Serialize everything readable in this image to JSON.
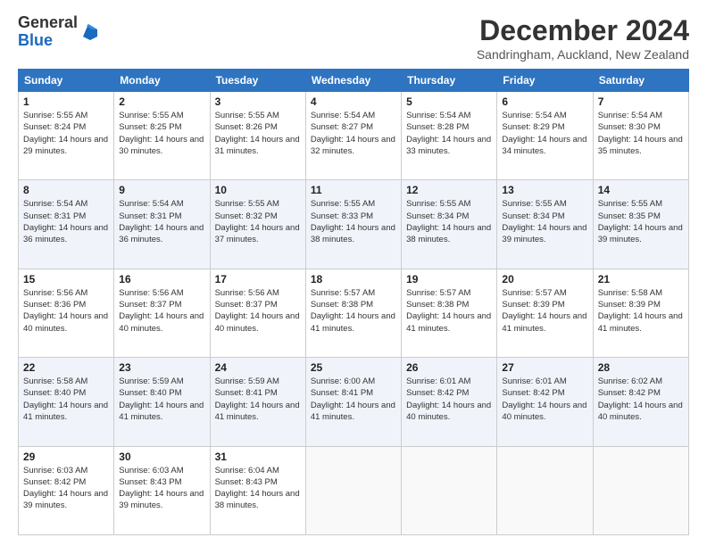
{
  "header": {
    "logo_general": "General",
    "logo_blue": "Blue",
    "month_title": "December 2024",
    "location": "Sandringham, Auckland, New Zealand"
  },
  "days_of_week": [
    "Sunday",
    "Monday",
    "Tuesday",
    "Wednesday",
    "Thursday",
    "Friday",
    "Saturday"
  ],
  "weeks": [
    [
      {
        "num": "1",
        "sunrise": "Sunrise: 5:55 AM",
        "sunset": "Sunset: 8:24 PM",
        "daylight": "Daylight: 14 hours and 29 minutes."
      },
      {
        "num": "2",
        "sunrise": "Sunrise: 5:55 AM",
        "sunset": "Sunset: 8:25 PM",
        "daylight": "Daylight: 14 hours and 30 minutes."
      },
      {
        "num": "3",
        "sunrise": "Sunrise: 5:55 AM",
        "sunset": "Sunset: 8:26 PM",
        "daylight": "Daylight: 14 hours and 31 minutes."
      },
      {
        "num": "4",
        "sunrise": "Sunrise: 5:54 AM",
        "sunset": "Sunset: 8:27 PM",
        "daylight": "Daylight: 14 hours and 32 minutes."
      },
      {
        "num": "5",
        "sunrise": "Sunrise: 5:54 AM",
        "sunset": "Sunset: 8:28 PM",
        "daylight": "Daylight: 14 hours and 33 minutes."
      },
      {
        "num": "6",
        "sunrise": "Sunrise: 5:54 AM",
        "sunset": "Sunset: 8:29 PM",
        "daylight": "Daylight: 14 hours and 34 minutes."
      },
      {
        "num": "7",
        "sunrise": "Sunrise: 5:54 AM",
        "sunset": "Sunset: 8:30 PM",
        "daylight": "Daylight: 14 hours and 35 minutes."
      }
    ],
    [
      {
        "num": "8",
        "sunrise": "Sunrise: 5:54 AM",
        "sunset": "Sunset: 8:31 PM",
        "daylight": "Daylight: 14 hours and 36 minutes."
      },
      {
        "num": "9",
        "sunrise": "Sunrise: 5:54 AM",
        "sunset": "Sunset: 8:31 PM",
        "daylight": "Daylight: 14 hours and 36 minutes."
      },
      {
        "num": "10",
        "sunrise": "Sunrise: 5:55 AM",
        "sunset": "Sunset: 8:32 PM",
        "daylight": "Daylight: 14 hours and 37 minutes."
      },
      {
        "num": "11",
        "sunrise": "Sunrise: 5:55 AM",
        "sunset": "Sunset: 8:33 PM",
        "daylight": "Daylight: 14 hours and 38 minutes."
      },
      {
        "num": "12",
        "sunrise": "Sunrise: 5:55 AM",
        "sunset": "Sunset: 8:34 PM",
        "daylight": "Daylight: 14 hours and 38 minutes."
      },
      {
        "num": "13",
        "sunrise": "Sunrise: 5:55 AM",
        "sunset": "Sunset: 8:34 PM",
        "daylight": "Daylight: 14 hours and 39 minutes."
      },
      {
        "num": "14",
        "sunrise": "Sunrise: 5:55 AM",
        "sunset": "Sunset: 8:35 PM",
        "daylight": "Daylight: 14 hours and 39 minutes."
      }
    ],
    [
      {
        "num": "15",
        "sunrise": "Sunrise: 5:56 AM",
        "sunset": "Sunset: 8:36 PM",
        "daylight": "Daylight: 14 hours and 40 minutes."
      },
      {
        "num": "16",
        "sunrise": "Sunrise: 5:56 AM",
        "sunset": "Sunset: 8:37 PM",
        "daylight": "Daylight: 14 hours and 40 minutes."
      },
      {
        "num": "17",
        "sunrise": "Sunrise: 5:56 AM",
        "sunset": "Sunset: 8:37 PM",
        "daylight": "Daylight: 14 hours and 40 minutes."
      },
      {
        "num": "18",
        "sunrise": "Sunrise: 5:57 AM",
        "sunset": "Sunset: 8:38 PM",
        "daylight": "Daylight: 14 hours and 41 minutes."
      },
      {
        "num": "19",
        "sunrise": "Sunrise: 5:57 AM",
        "sunset": "Sunset: 8:38 PM",
        "daylight": "Daylight: 14 hours and 41 minutes."
      },
      {
        "num": "20",
        "sunrise": "Sunrise: 5:57 AM",
        "sunset": "Sunset: 8:39 PM",
        "daylight": "Daylight: 14 hours and 41 minutes."
      },
      {
        "num": "21",
        "sunrise": "Sunrise: 5:58 AM",
        "sunset": "Sunset: 8:39 PM",
        "daylight": "Daylight: 14 hours and 41 minutes."
      }
    ],
    [
      {
        "num": "22",
        "sunrise": "Sunrise: 5:58 AM",
        "sunset": "Sunset: 8:40 PM",
        "daylight": "Daylight: 14 hours and 41 minutes."
      },
      {
        "num": "23",
        "sunrise": "Sunrise: 5:59 AM",
        "sunset": "Sunset: 8:40 PM",
        "daylight": "Daylight: 14 hours and 41 minutes."
      },
      {
        "num": "24",
        "sunrise": "Sunrise: 5:59 AM",
        "sunset": "Sunset: 8:41 PM",
        "daylight": "Daylight: 14 hours and 41 minutes."
      },
      {
        "num": "25",
        "sunrise": "Sunrise: 6:00 AM",
        "sunset": "Sunset: 8:41 PM",
        "daylight": "Daylight: 14 hours and 41 minutes."
      },
      {
        "num": "26",
        "sunrise": "Sunrise: 6:01 AM",
        "sunset": "Sunset: 8:42 PM",
        "daylight": "Daylight: 14 hours and 40 minutes."
      },
      {
        "num": "27",
        "sunrise": "Sunrise: 6:01 AM",
        "sunset": "Sunset: 8:42 PM",
        "daylight": "Daylight: 14 hours and 40 minutes."
      },
      {
        "num": "28",
        "sunrise": "Sunrise: 6:02 AM",
        "sunset": "Sunset: 8:42 PM",
        "daylight": "Daylight: 14 hours and 40 minutes."
      }
    ],
    [
      {
        "num": "29",
        "sunrise": "Sunrise: 6:03 AM",
        "sunset": "Sunset: 8:42 PM",
        "daylight": "Daylight: 14 hours and 39 minutes."
      },
      {
        "num": "30",
        "sunrise": "Sunrise: 6:03 AM",
        "sunset": "Sunset: 8:43 PM",
        "daylight": "Daylight: 14 hours and 39 minutes."
      },
      {
        "num": "31",
        "sunrise": "Sunrise: 6:04 AM",
        "sunset": "Sunset: 8:43 PM",
        "daylight": "Daylight: 14 hours and 38 minutes."
      },
      {
        "num": "",
        "sunrise": "",
        "sunset": "",
        "daylight": ""
      },
      {
        "num": "",
        "sunrise": "",
        "sunset": "",
        "daylight": ""
      },
      {
        "num": "",
        "sunrise": "",
        "sunset": "",
        "daylight": ""
      },
      {
        "num": "",
        "sunrise": "",
        "sunset": "",
        "daylight": ""
      }
    ]
  ]
}
